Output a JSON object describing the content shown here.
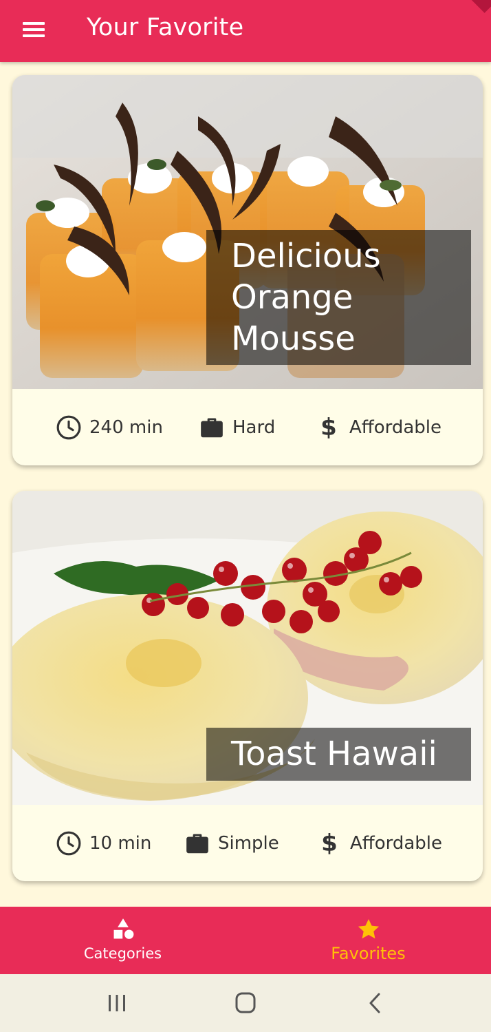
{
  "app_bar": {
    "title": "Your Favorite",
    "menu_icon": "menu-icon",
    "background": "#e82c57"
  },
  "meals": [
    {
      "title": "Delicious Orange Mousse",
      "duration": "240 min",
      "complexity": "Hard",
      "affordability": "Affordable",
      "image": "orange-mousse-photo"
    },
    {
      "title": "Toast Hawaii",
      "duration": "10 min",
      "complexity": "Simple",
      "affordability": "Affordable",
      "image": "toast-hawaii-photo"
    }
  ],
  "bottom_nav": {
    "items": [
      {
        "label": "Categories",
        "icon": "category-icon",
        "selected": false
      },
      {
        "label": "Favorites",
        "icon": "star-icon",
        "selected": true
      }
    ],
    "selected_color": "#ffc107",
    "unselected_color": "#ffffff"
  },
  "system_nav": {
    "recents_icon": "recents-icon",
    "home_icon": "home-icon",
    "back_icon": "back-icon"
  },
  "colors": {
    "accent": "#e82c57",
    "background": "#fff8dc",
    "card": "#fffde8"
  }
}
